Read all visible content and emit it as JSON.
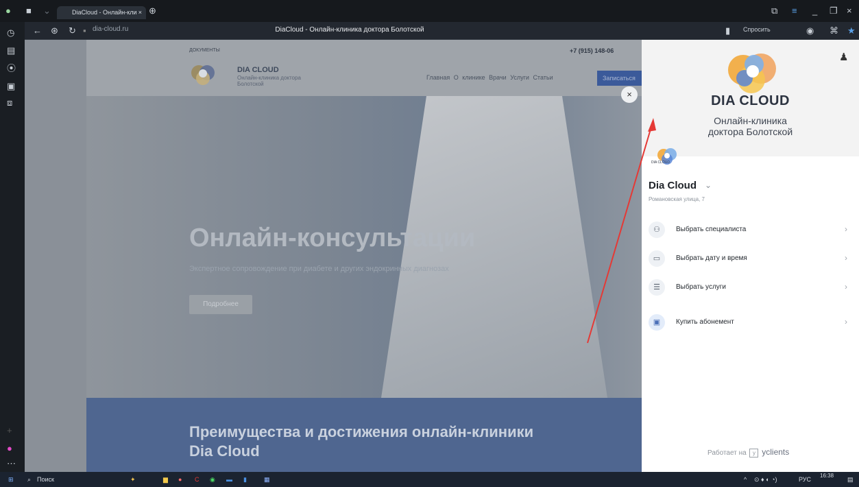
{
  "browser": {
    "tab_title": "DiaCloud - Онлайн-кли",
    "url": "dia-cloud.ru",
    "page_title": "DiaCloud - Онлайн-клиника доктора Болотской",
    "ask_label": "Спросить"
  },
  "site": {
    "docs_link": "ДОКУМЕНТЫ",
    "phone": "+7 (915) 148-06",
    "brand": "DIA CLOUD",
    "brand_sub": "Онлайн-клиника доктора Болотской",
    "nav": [
      "Главная",
      "О клинике",
      "Врачи",
      "Услуги",
      "Статьи"
    ],
    "signup_button": "Записаться",
    "hero_title": "Онлайн-консультации",
    "hero_subtitle": "Экспертное сопровождение при диабете и других эндокринных диагнозах",
    "more_button": "Подробнее",
    "advantages_title": "Преимущества и достижения онлайн-клиники Dia Cloud"
  },
  "widget": {
    "close_icon": "×",
    "brand": "DIA CLOUD",
    "subtitle_line1": "Онлайн-клиника",
    "subtitle_line2": "доктора Болотской",
    "small_logo_text": "DIA CLOUD",
    "location_name": "Dia Cloud",
    "address": "Романовская улица, 7",
    "menu": [
      {
        "label": "Выбрать специалиста",
        "icon": "people-icon"
      },
      {
        "label": "Выбрать дату и время",
        "icon": "calendar-icon"
      },
      {
        "label": "Выбрать услуги",
        "icon": "list-icon"
      },
      {
        "label": "Купить абонемент",
        "icon": "subscription-icon"
      }
    ],
    "powered_by": "Работает на",
    "powered_brand": "yclients"
  },
  "taskbar": {
    "search_label": "Поиск",
    "lang": "РУС",
    "time": "16:38"
  }
}
